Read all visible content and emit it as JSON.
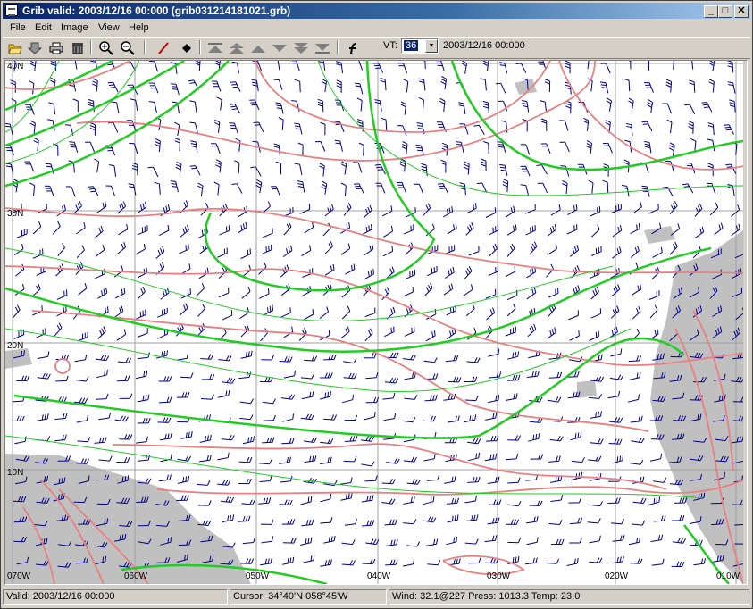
{
  "window": {
    "title": "Grib valid: 2003/12/16 00:000 (grib031214181021.grb)"
  },
  "window_controls": {
    "minimize": "_",
    "maximize": "□",
    "close": "✕"
  },
  "menu": {
    "items": [
      "File",
      "Edit",
      "Image",
      "View",
      "Help"
    ]
  },
  "toolbar": {
    "icons": [
      "open-folder-icon",
      "save-icon",
      "print-icon",
      "delete-icon",
      "zoom-in-icon",
      "zoom-out-icon",
      "draw-line-icon",
      "waypoint-icon",
      "top-icon",
      "up-fast-icon",
      "up-icon",
      "down-icon",
      "down-fast-icon",
      "bottom-icon",
      "function-icon"
    ],
    "vt_label": "VT:",
    "vt_value": "36",
    "valid_time": "2003/12/16 00:000"
  },
  "map": {
    "lat_labels": [
      "40N",
      "30N",
      "20N",
      "10N"
    ],
    "lon_labels": [
      "070W",
      "060W",
      "050W",
      "040W",
      "030W",
      "020W",
      "010W"
    ],
    "colors": {
      "land": "#c0c0c0",
      "isobar": "#e88080",
      "isotherm": "#22cc22",
      "wind": "#00008b",
      "grid": "#a0a0a0"
    }
  },
  "status": {
    "valid": "Valid: 2003/12/16 00:000",
    "cursor": "Cursor: 34°40'N  058°45'W",
    "wind": "Wind: 32.1@227  Press: 1013.3 Temp: 23.0"
  }
}
